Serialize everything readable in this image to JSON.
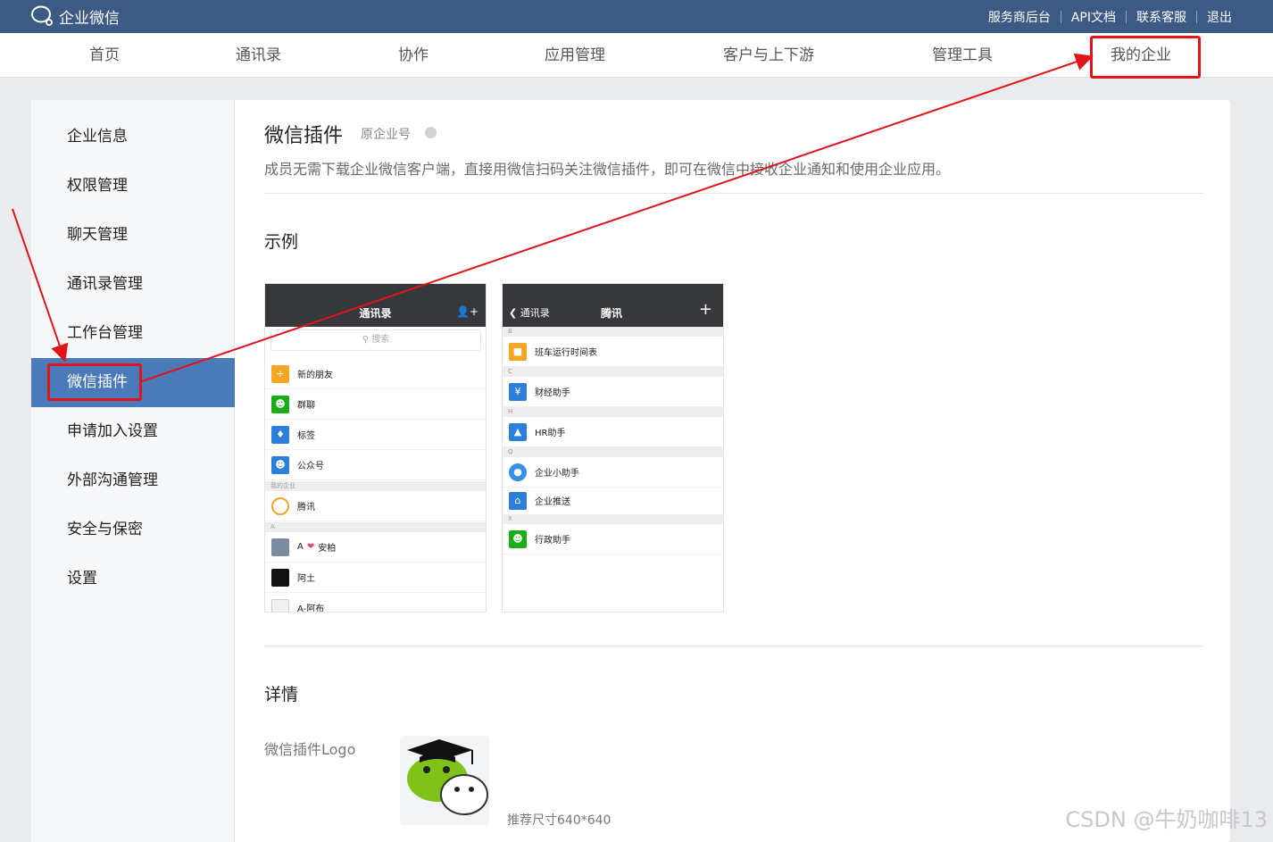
{
  "app": {
    "brand": "企业微信"
  },
  "toplinks": [
    "服务商后台",
    "API文档",
    "联系客服",
    "退出"
  ],
  "nav": [
    {
      "label": "首页"
    },
    {
      "label": "通讯录"
    },
    {
      "label": "协作"
    },
    {
      "label": "应用管理"
    },
    {
      "label": "客户与上下游"
    },
    {
      "label": "管理工具"
    },
    {
      "label": "我的企业"
    }
  ],
  "sidebar": {
    "items": [
      {
        "label": "企业信息"
      },
      {
        "label": "权限管理"
      },
      {
        "label": "聊天管理"
      },
      {
        "label": "通讯录管理"
      },
      {
        "label": "工作台管理"
      },
      {
        "label": "微信插件",
        "active": true
      },
      {
        "label": "申请加入设置"
      },
      {
        "label": "外部沟通管理"
      },
      {
        "label": "安全与保密"
      },
      {
        "label": "设置"
      }
    ]
  },
  "main": {
    "title": "微信插件",
    "tag": "原企业号",
    "description": "成员无需下载企业微信客户端，直接用微信扫码关注微信插件，即可在微信中接收企业通知和使用企业应用。",
    "example_title": "示例",
    "details_title": "详情",
    "logo_label": "微信插件Logo",
    "logo_hint": "推荐尺寸640*640"
  },
  "phone1": {
    "title": "通讯录",
    "search": "搜索",
    "rows": [
      "新的朋友",
      "群聊",
      "标签",
      "公众号"
    ],
    "group_label": "我的企业",
    "company": "腾讯",
    "group_a": "A",
    "contacts": [
      "A",
      "安柏",
      "阿土",
      "A-阿布"
    ]
  },
  "phone2": {
    "back": "通讯录",
    "title": "腾讯",
    "plus": "+",
    "groups": [
      "B",
      "C",
      "H",
      "Q",
      "X"
    ],
    "rows": [
      "班车运行时间表",
      "财经助手",
      "HR助手",
      "企业小助手",
      "企业推送",
      "行政助手"
    ]
  },
  "watermark": "CSDN @牛奶咖啡13",
  "colors": {
    "topbar": "#3c5a84",
    "active": "#4a7ab8",
    "annotation": "#e0141b"
  }
}
